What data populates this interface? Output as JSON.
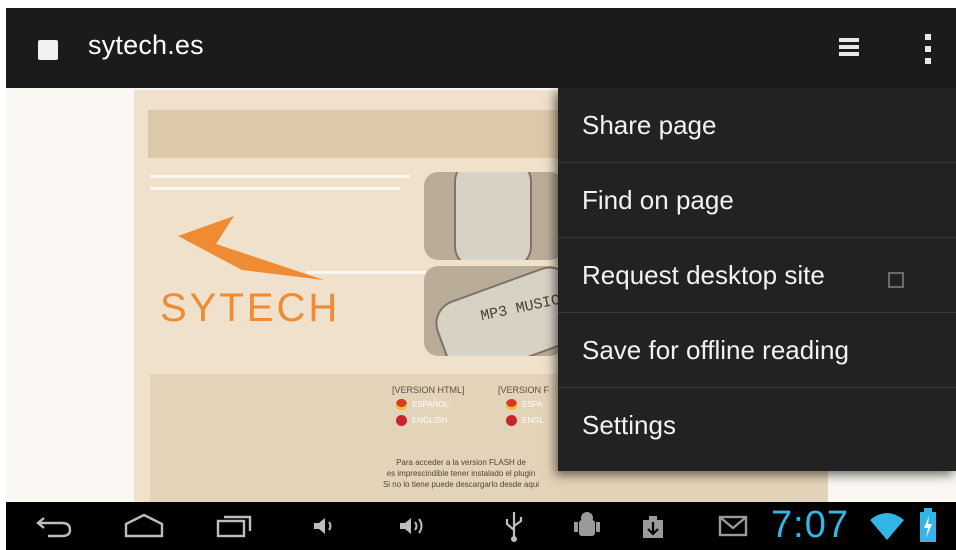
{
  "browser": {
    "address_title": "sytech.es",
    "tabs_icon": "tabs-stack-icon",
    "overflow_icon": "overflow-menu-icon"
  },
  "webpage": {
    "logo_text": "SYTECH",
    "device_label": "MP3 MUSIC",
    "version_html": "[VERSION HTML]",
    "version_flash": "[VERSION F",
    "lang_es": "ESPAÑOL",
    "lang_en": "ENGLISH",
    "lang_es_short": "ESPA",
    "lang_en_short": "ENGL",
    "blurb_line1": "Para acceder a la version FLASH de",
    "blurb_line2": "es imprescindible tener instalado el plugin",
    "blurb_line3": "Si no lo tiene puede descargarlo desde aqui"
  },
  "menu": {
    "items": [
      {
        "label": "Share page"
      },
      {
        "label": "Find on page"
      },
      {
        "label": "Request desktop site",
        "checked": false
      },
      {
        "label": "Save for offline reading"
      },
      {
        "label": "Settings"
      }
    ]
  },
  "system_bar": {
    "icons": [
      "back-icon",
      "home-icon",
      "recent-apps-icon",
      "volume-down-icon",
      "volume-up-icon",
      "usb-icon",
      "debug-android-icon",
      "download-icon",
      "gmail-icon",
      "wifi-icon",
      "battery-icon"
    ],
    "clock": "7:07",
    "accent": "#33b5e5"
  }
}
